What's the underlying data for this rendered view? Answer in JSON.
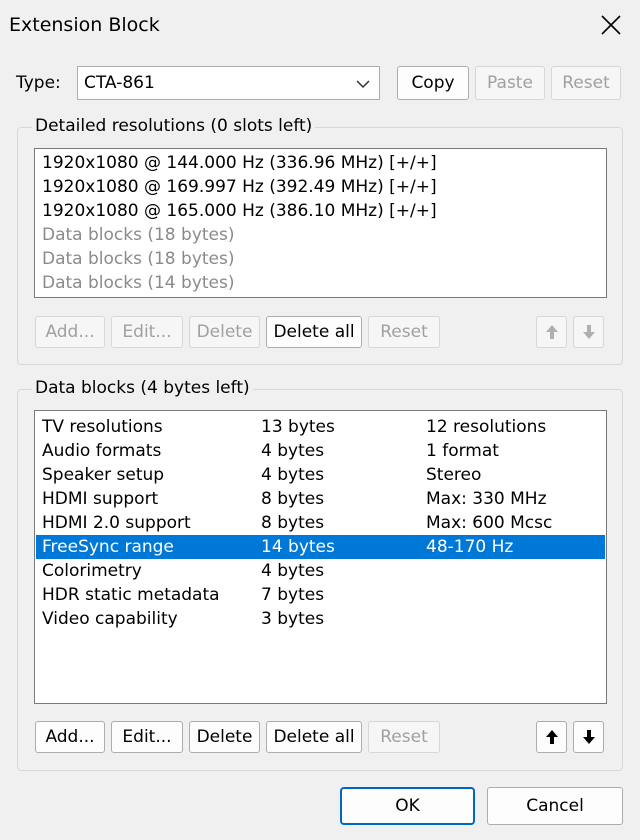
{
  "window": {
    "title": "Extension Block"
  },
  "type_field": {
    "label": "Type:",
    "value": "CTA-861"
  },
  "top_buttons": {
    "copy": "Copy",
    "paste": "Paste",
    "reset": "Reset"
  },
  "detailed": {
    "caption": "Detailed resolutions (0 slots left)",
    "items": [
      "1920x1080 @ 144.000 Hz (336.96 MHz) [+/+]",
      "1920x1080 @ 169.997 Hz (392.49 MHz) [+/+]",
      "1920x1080 @ 165.000 Hz (386.10 MHz) [+/+]",
      "Data blocks (18 bytes)",
      "Data blocks (18 bytes)",
      "Data blocks (14 bytes)"
    ],
    "buttons": {
      "add": "Add...",
      "edit": "Edit...",
      "delete": "Delete",
      "delete_all": "Delete all",
      "reset": "Reset"
    }
  },
  "data_blocks": {
    "caption": "Data blocks (4 bytes left)",
    "rows": [
      {
        "name": "TV resolutions",
        "bytes": "13 bytes",
        "info": "12 resolutions"
      },
      {
        "name": "Audio formats",
        "bytes": "4 bytes",
        "info": "1 format"
      },
      {
        "name": "Speaker setup",
        "bytes": "4 bytes",
        "info": "Stereo"
      },
      {
        "name": "HDMI support",
        "bytes": "8 bytes",
        "info": "Max: 330 MHz"
      },
      {
        "name": "HDMI 2.0 support",
        "bytes": "8 bytes",
        "info": "Max: 600 Mcsc"
      },
      {
        "name": "FreeSync range",
        "bytes": "14 bytes",
        "info": "48-170 Hz"
      },
      {
        "name": "Colorimetry",
        "bytes": "4 bytes",
        "info": ""
      },
      {
        "name": "HDR static metadata",
        "bytes": "7 bytes",
        "info": ""
      },
      {
        "name": "Video capability",
        "bytes": "3 bytes",
        "info": ""
      }
    ],
    "selected_index": 5,
    "buttons": {
      "add": "Add...",
      "edit": "Edit...",
      "delete": "Delete",
      "delete_all": "Delete all",
      "reset": "Reset"
    }
  },
  "footer": {
    "ok": "OK",
    "cancel": "Cancel"
  },
  "colors": {
    "selection": "#0078d7",
    "primary_border": "#0067c0",
    "disabled_text": "#a0a0a0"
  }
}
